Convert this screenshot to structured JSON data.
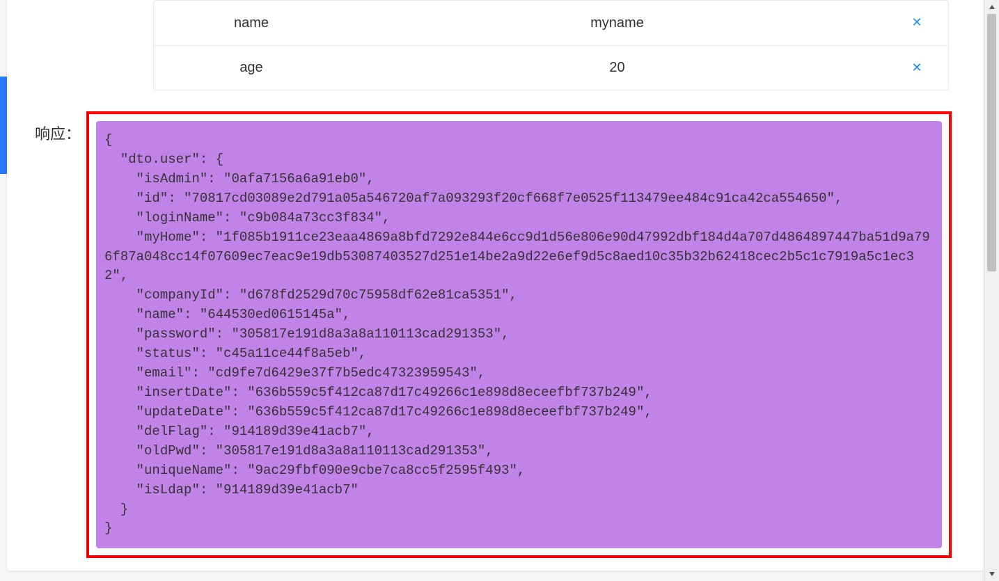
{
  "sidebar": {},
  "params": {
    "rows": [
      {
        "key": "name",
        "value": "myname"
      },
      {
        "key": "age",
        "value": "20"
      }
    ]
  },
  "response": {
    "label": "响应：",
    "json": "{\n  \"dto.user\": {\n    \"isAdmin\": \"0afa7156a6a91eb0\",\n    \"id\": \"70817cd03089e2d791a05a546720af7a093293f20cf668f7e0525f113479ee484c91ca42ca554650\",\n    \"loginName\": \"c9b084a73cc3f834\",\n    \"myHome\": \"1f085b1911ce23eaa4869a8bfd7292e844e6cc9d1d56e806e90d47992dbf184d4a707d4864897447ba51d9a796f87a048cc14f07609ec7eac9e19db53087403527d251e14be2a9d22e6ef9d5c8aed10c35b32b62418cec2b5c1c7919a5c1ec32\",\n    \"companyId\": \"d678fd2529d70c75958df62e81ca5351\",\n    \"name\": \"644530ed0615145a\",\n    \"password\": \"305817e191d8a3a8a110113cad291353\",\n    \"status\": \"c45a11ce44f8a5eb\",\n    \"email\": \"cd9fe7d6429e37f7b5edc47323959543\",\n    \"insertDate\": \"636b559c5f412ca87d17c49266c1e898d8eceefbf737b249\",\n    \"updateDate\": \"636b559c5f412ca87d17c49266c1e898d8eceefbf737b249\",\n    \"delFlag\": \"914189d39e41acb7\",\n    \"oldPwd\": \"305817e191d8a3a8a110113cad291353\",\n    \"uniqueName\": \"9ac29fbf090e9cbe7ca8cc5f2595f493\",\n    \"isLdap\": \"914189d39e41acb7\"\n  }\n}"
  }
}
